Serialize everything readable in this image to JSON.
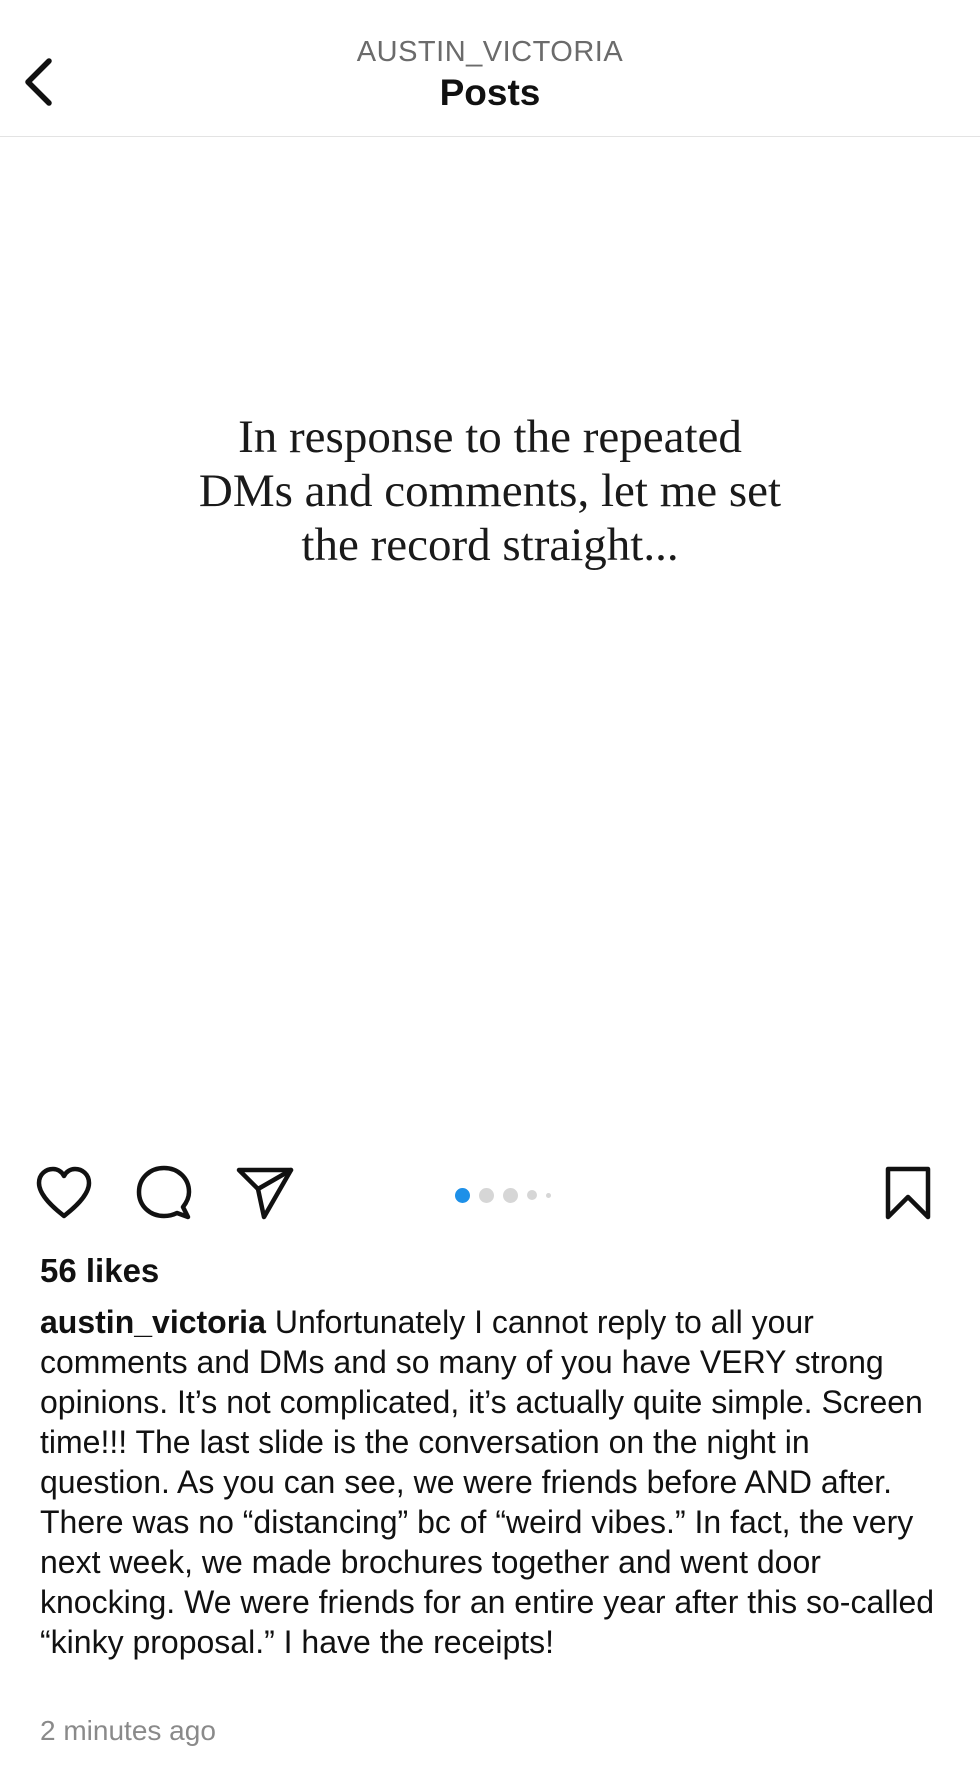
{
  "header": {
    "account": "AUSTIN_VICTORIA",
    "title": "Posts",
    "back_icon": "chevron-left-icon"
  },
  "post": {
    "image_text": "In response to the repeated DMs and comments, let me set the record straight...",
    "carousel": {
      "total_slides": 5,
      "current_slide": 1,
      "active_color": "#1e90e8",
      "inactive_color": "#d6d6d6"
    },
    "actions": {
      "like_icon": "heart-icon",
      "comment_icon": "comment-icon",
      "share_icon": "paper-plane-icon",
      "save_icon": "bookmark-icon"
    },
    "likes": "56 likes",
    "caption": {
      "username": "austin_victoria",
      "text": "Unfortunately I cannot reply to all your comments and DMs and so many of you have VERY strong opinions. It’s not complicated, it’s actually quite simple. Screen time!!! The last slide is the conversation on the night in question. As you can see, we were friends before AND after. There was no “distancing” bc of “weird vibes.” In fact, the very next week, we made brochures together and went door knocking. We were friends for an entire year after this so-called “kinky proposal.” I have the receipts!"
    },
    "timestamp": "2 minutes ago"
  }
}
